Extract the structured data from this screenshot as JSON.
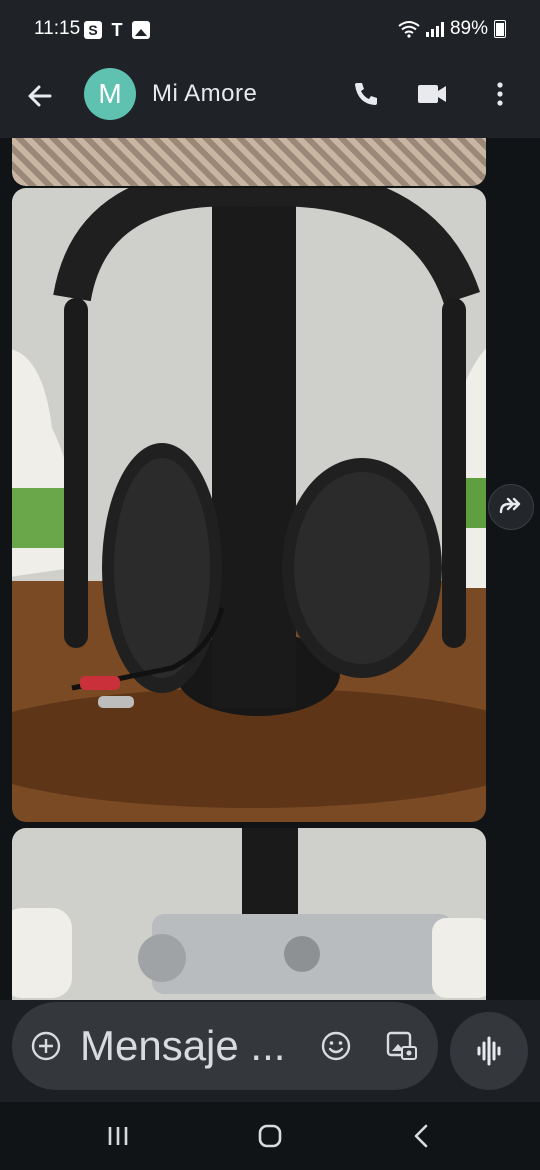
{
  "status_bar": {
    "time": "11:15",
    "carrier_icon_s": "S",
    "carrier_icon_t": "T",
    "battery_text": "89%",
    "icons": [
      "samsung-s-icon",
      "t-mobile-icon",
      "gallery-notification-icon",
      "wifi-icon",
      "signal-icon",
      "battery-icon"
    ]
  },
  "header": {
    "avatar_initial": "M",
    "contact_name": "Mi  Amore",
    "icons": [
      "back-arrow-icon",
      "phone-icon",
      "video-call-icon",
      "more-vert-icon"
    ]
  },
  "conversation": {
    "images": [
      {
        "description_name": "doily-photo"
      },
      {
        "description_name": "headphones-photo"
      },
      {
        "description_name": "metal-clamp-photo"
      }
    ],
    "forward_icon": "forward-icon"
  },
  "composer": {
    "placeholder": "Mensaje ...",
    "icons": [
      "add-icon",
      "emoji-icon",
      "gallery-icon",
      "voice-icon"
    ]
  },
  "nav": {
    "icons": [
      "recents-icon",
      "home-icon",
      "back-icon"
    ]
  },
  "colors": {
    "avatar": "#5fc1b0",
    "header_bg": "#1f2226",
    "conversation_bg": "#111417",
    "field_bg": "#34383d"
  }
}
